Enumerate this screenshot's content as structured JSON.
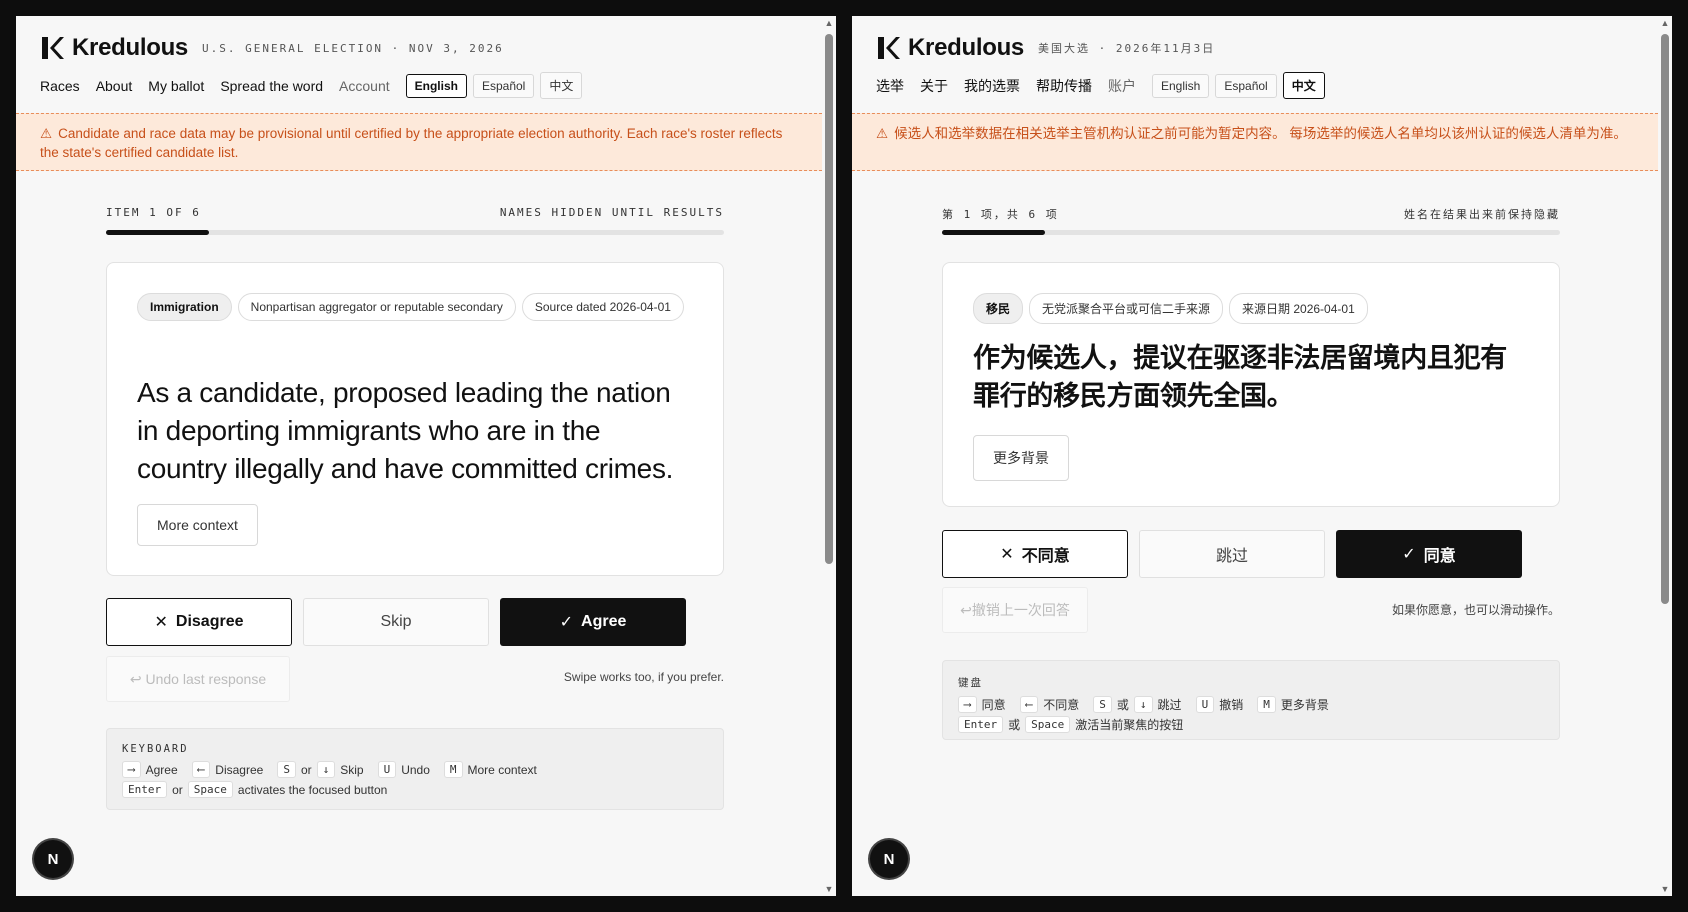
{
  "windows": [
    {
      "brand": "Kredulous",
      "subtitle": "U.S. GENERAL ELECTION · NOV 3, 2026",
      "nav": [
        "Races",
        "About",
        "My ballot",
        "Spread the word",
        "Account"
      ],
      "languages": [
        "English",
        "Español",
        "中文"
      ],
      "active_language": "English",
      "banner": "Candidate and race data may be provisional until certified by the appropriate election authority. Each race's roster reflects the state's certified candidate list.",
      "progress_label": "ITEM 1 OF 6",
      "names_hidden": "NAMES HIDDEN UNTIL RESULTS",
      "progress_fraction": 0.167,
      "chips": [
        "Immigration",
        "Nonpartisan aggregator or reputable secondary",
        "Source dated 2026-04-01"
      ],
      "statement": "As a candidate, proposed leading the nation in deporting immigrants who are in the country illegally and have committed crimes.",
      "more_context": "More context",
      "disagree": "Disagree",
      "skip": "Skip",
      "agree": "Agree",
      "undo": "↩ Undo last response",
      "swipe_hint": "Swipe works too, if you prefer.",
      "keyboard_title": "KEYBOARD",
      "kbd": {
        "agree": "Agree",
        "disagree": "Disagree",
        "or": "or",
        "skip": "Skip",
        "undo": "Undo",
        "more": "More context",
        "enter_or": "or",
        "activates": "activates the focused button"
      },
      "avatar": "N"
    },
    {
      "brand": "Kredulous",
      "subtitle": "美国大选 · 2026年11月3日",
      "nav": [
        "选举",
        "关于",
        "我的选票",
        "帮助传播",
        "账户"
      ],
      "languages": [
        "English",
        "Español",
        "中文"
      ],
      "active_language": "中文",
      "banner": "候选人和选举数据在相关选举主管机构认证之前可能为暂定内容。 每场选举的候选人名单均以该州认证的候选人清单为准。",
      "progress_label": "第 1 项，共 6 项",
      "names_hidden": "姓名在结果出来前保持隐藏",
      "progress_fraction": 0.167,
      "chips": [
        "移民",
        "无党派聚合平台或可信二手来源",
        "来源日期 2026-04-01"
      ],
      "statement": "作为候选人，提议在驱逐非法居留境内且犯有罪行的移民方面领先全国。",
      "more_context": "更多背景",
      "disagree": "不同意",
      "skip": "跳过",
      "agree": "同意",
      "undo": "↩撤销上一次回答",
      "swipe_hint": "如果你愿意，也可以滑动操作。",
      "keyboard_title": "键盘",
      "kbd": {
        "agree": "同意",
        "disagree": "不同意",
        "or": "或",
        "skip": "跳过",
        "undo": "撤销",
        "more": "更多背景",
        "enter_or": "或",
        "activates": "激活当前聚焦的按钮"
      },
      "avatar": "N"
    }
  ],
  "keys": {
    "right_arrow": "⟶",
    "left_arrow": "⟵",
    "s": "S",
    "down_arrow": "↓",
    "u": "U",
    "m": "M",
    "enter": "Enter",
    "space": "Space"
  },
  "colors": {
    "banner_bg": "#fde9da",
    "banner_text": "#c7501a",
    "accent": "#111111"
  }
}
